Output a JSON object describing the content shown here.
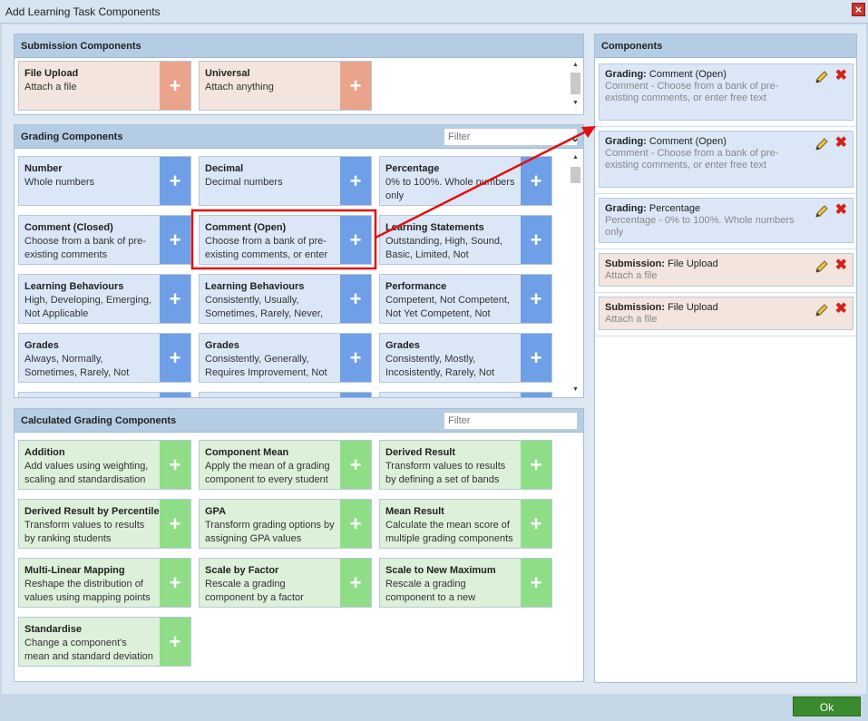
{
  "window": {
    "title": "Add Learning Task Components",
    "close": "×"
  },
  "submission": {
    "header": "Submission Components",
    "cards": [
      {
        "name": "File Upload",
        "desc": "Attach a file"
      },
      {
        "name": "Universal",
        "desc": "Attach anything"
      }
    ]
  },
  "grading": {
    "header": "Grading Components",
    "filter_placeholder": "Filter",
    "cards": [
      {
        "name": "Number",
        "desc": "Whole numbers"
      },
      {
        "name": "Decimal",
        "desc": "Decimal numbers"
      },
      {
        "name": "Percentage",
        "desc": "0% to 100%. Whole numbers only"
      },
      {
        "name": "Comment (Closed)",
        "desc": "Choose from a bank of pre-existing comments"
      },
      {
        "name": "Comment (Open)",
        "desc": "Choose from a bank of pre-existing comments, or enter"
      },
      {
        "name": "Learning Statements",
        "desc": "Outstanding, High, Sound, Basic, Limited, Not Applicable"
      },
      {
        "name": "Learning Behaviours",
        "desc": "High, Developing, Emerging, Not Applicable"
      },
      {
        "name": "Learning Behaviours",
        "desc": "Consistently, Usually, Sometimes, Rarely, Never, Not"
      },
      {
        "name": "Performance",
        "desc": "Competent, Not Competent, Not Yet Competent, Not"
      },
      {
        "name": "Grades",
        "desc": "Always, Normally, Sometimes, Rarely, Not Applicable"
      },
      {
        "name": "Grades",
        "desc": "Consistently, Generally, Requires Improvement, Not"
      },
      {
        "name": "Grades",
        "desc": "Consistently, Mostly, Incosistently, Rarely, Not"
      }
    ]
  },
  "calculated": {
    "header": "Calculated Grading Components",
    "filter_placeholder": "Filter",
    "cards": [
      {
        "name": "Addition",
        "desc": "Add values using weighting, scaling and standardisation"
      },
      {
        "name": "Component Mean",
        "desc": "Apply the mean of a grading component to every student"
      },
      {
        "name": "Derived Result",
        "desc": "Transform values to results by defining a set of bands"
      },
      {
        "name": "Derived Result by Percentile",
        "desc": "Transform values to results by ranking students"
      },
      {
        "name": "GPA",
        "desc": "Transform grading options by assigning GPA values"
      },
      {
        "name": "Mean Result",
        "desc": "Calculate the mean score of multiple grading components"
      },
      {
        "name": "Multi-Linear Mapping",
        "desc": "Reshape the distribution of values using mapping points"
      },
      {
        "name": "Scale by Factor",
        "desc": "Rescale a grading component by a factor"
      },
      {
        "name": "Scale to New Maximum",
        "desc": "Rescale a grading component to a new maximum value"
      },
      {
        "name": "Standardise",
        "desc": "Change a component's mean and standard deviation"
      }
    ]
  },
  "components": {
    "header": "Components",
    "items": [
      {
        "kind": "Grading:",
        "name": "Comment (Open)",
        "desc": "Comment - Choose from a bank of pre-existing comments, or enter free text"
      },
      {
        "kind": "Grading:",
        "name": "Comment (Open)",
        "desc": "Comment - Choose from a bank of pre-existing comments, or enter free text"
      },
      {
        "kind": "Grading:",
        "name": "Percentage",
        "desc": "Percentage - 0% to 100%. Whole numbers only"
      },
      {
        "kind": "Submission:",
        "name": "File Upload",
        "desc": "Attach a file"
      },
      {
        "kind": "Submission:",
        "name": "File Upload",
        "desc": "Attach a file"
      }
    ]
  },
  "plus_glyph": "+",
  "footer": {
    "ok_label": "Ok"
  },
  "colors": {
    "highlight": "#e01010",
    "ok": "#3a8a2e",
    "grading_plus": "#6f9fe6",
    "submission_plus": "#eaa48c",
    "calculated_plus": "#90dd88"
  }
}
